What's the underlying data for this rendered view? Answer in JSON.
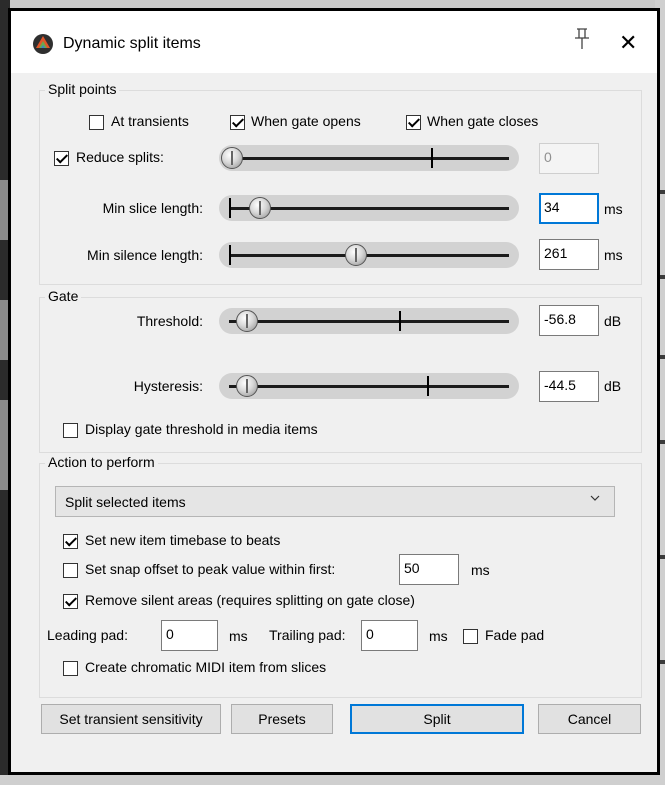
{
  "window": {
    "title": "Dynamic split items",
    "icons": {
      "app": "reaper-logo-icon",
      "pin": "pin-icon",
      "close": "close-icon"
    },
    "close_glyph": "✕"
  },
  "split_points": {
    "label": "Split points",
    "at_transients": {
      "label": "At transients",
      "checked": false
    },
    "when_gate_opens": {
      "label": "When gate opens",
      "checked": true
    },
    "when_gate_closes": {
      "label": "When gate closes",
      "checked": true
    },
    "reduce_splits": {
      "label": "Reduce splits:",
      "checked": true,
      "value": "0",
      "slider_level": 0.0
    },
    "min_slice_length": {
      "label": "Min slice length:",
      "value": "34",
      "unit": "ms",
      "slider_level": 0.1
    },
    "min_silence_length": {
      "label": "Min silence length:",
      "value": "261",
      "unit": "ms",
      "slider_level": 0.43
    }
  },
  "gate": {
    "label": "Gate",
    "threshold": {
      "label": "Threshold:",
      "value": "-56.8",
      "unit": "dB",
      "slider_level": 0.06
    },
    "hysteresis": {
      "label": "Hysteresis:",
      "value": "-44.5",
      "unit": "dB",
      "slider_level": 0.06
    },
    "display_threshold": {
      "label": "Display gate threshold in media items",
      "checked": false
    }
  },
  "action": {
    "label": "Action to perform",
    "selected": "Split selected items",
    "set_timebase_beats": {
      "label": "Set new item timebase to beats",
      "checked": true
    },
    "snap_offset": {
      "label": "Set snap offset to peak value within first:",
      "checked": false,
      "value": "50",
      "unit": "ms"
    },
    "remove_silent": {
      "label": "Remove silent areas (requires splitting on gate close)",
      "checked": true
    },
    "leading_pad": {
      "label": "Leading pad:",
      "value": "0",
      "unit": "ms"
    },
    "trailing_pad": {
      "label": "Trailing pad:",
      "value": "0",
      "unit": "ms"
    },
    "fade_pad": {
      "label": "Fade pad",
      "checked": false
    },
    "chromatic_midi": {
      "label": "Create chromatic MIDI item from slices",
      "checked": false
    }
  },
  "buttons": {
    "transient_sensitivity": "Set transient sensitivity",
    "presets": "Presets",
    "split": "Split",
    "cancel": "Cancel"
  },
  "colors": {
    "accent": "#0078d7",
    "dialog_bg": "#f0f0f0",
    "slider_track": "#d2d2d2"
  }
}
